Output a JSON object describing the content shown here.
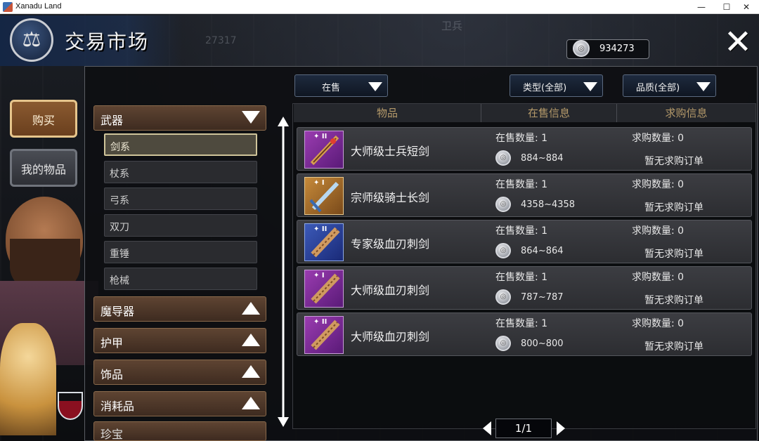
{
  "window": {
    "title": "Xanadu Land",
    "controls": {
      "minimize": "—",
      "maximize": "☐",
      "close": "✕"
    }
  },
  "header": {
    "title": "交易市场",
    "emblem_icon": "scales-icon",
    "currency_amount": "934273",
    "background_text": {
      "guard": "卫兵",
      "number": "27317"
    }
  },
  "side_tabs": {
    "buy": "购买",
    "my_items": "我的物品"
  },
  "categories": {
    "weapons": {
      "label": "武器",
      "subitems": [
        "剑系",
        "杖系",
        "弓系",
        "双刀",
        "重锤",
        "枪械"
      ],
      "selected": "剑系"
    },
    "others": [
      "魔导器",
      "护甲",
      "饰品",
      "消耗品"
    ],
    "partial": "珍宝"
  },
  "filters": {
    "status": "在售",
    "type": "类型(全部)",
    "quality": "品质(全部)"
  },
  "table": {
    "headers": [
      "物品",
      "在售信息",
      "求购信息"
    ],
    "rows": [
      {
        "tier": "II",
        "name": "大师级士兵短剑",
        "sale_label": "在售数量: 1",
        "price": "884~884",
        "buy_label": "求购数量: 0",
        "no_order": "暂无求购订单",
        "color": "purple"
      },
      {
        "tier": "I",
        "name": "宗师级骑士长剑",
        "sale_label": "在售数量: 1",
        "price": "4358~4358",
        "buy_label": "求购数量: 0",
        "no_order": "暂无求购订单",
        "color": "gold"
      },
      {
        "tier": "II",
        "name": "专家级血刃刺剑",
        "sale_label": "在售数量: 1",
        "price": "864~864",
        "buy_label": "求购数量: 0",
        "no_order": "暂无求购订单",
        "color": "blue"
      },
      {
        "tier": "I",
        "name": "大师级血刃刺剑",
        "sale_label": "在售数量: 1",
        "price": "787~787",
        "buy_label": "求购数量: 0",
        "no_order": "暂无求购订单",
        "color": "purple"
      },
      {
        "tier": "II",
        "name": "大师级血刃刺剑",
        "sale_label": "在售数量: 1",
        "price": "800~800",
        "buy_label": "求购数量: 0",
        "no_order": "暂无求购订单",
        "color": "purple"
      }
    ]
  },
  "pagination": {
    "label": "1/1"
  },
  "colors": {
    "accent_gold": "#e6c58c",
    "category_bg": "#5e4432",
    "purple_rarity": "#9a3cb0",
    "blue_rarity": "#3c5ab8",
    "gold_rarity": "#c68a3a"
  }
}
